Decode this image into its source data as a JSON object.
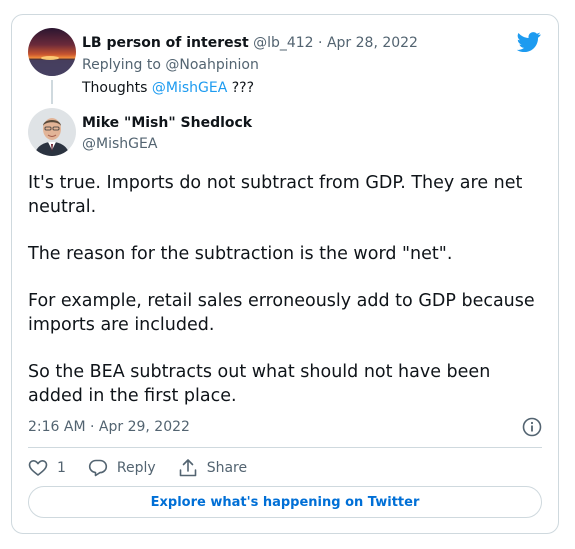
{
  "reply_tweet": {
    "author_name": "LB person of interest",
    "handle": "@lb_412",
    "separator": "·",
    "date": "Apr 28, 2022",
    "replying_prefix": "Replying to",
    "replying_to": "@Noahpinion",
    "text_prefix": "Thoughts",
    "mention": "@MishGEA",
    "text_suffix": "???",
    "avatar_icon": "sunset-avatar"
  },
  "main_tweet": {
    "author_name": "Mike \"Mish\" Shedlock",
    "handle": "@MishGEA",
    "avatar_icon": "man-portrait-avatar",
    "paragraphs": [
      "It's true. Imports do not subtract from GDP. They are net neutral.",
      "The reason for the subtraction is the word \"net\".",
      "For example, retail sales erroneously add to GDP because imports are included.",
      "So the BEA subtracts out what should not have been added in the first place."
    ],
    "timestamp": "2:16 AM · Apr 29, 2022"
  },
  "actions": {
    "like_count": "1",
    "reply_label": "Reply",
    "share_label": "Share"
  },
  "explore_label": "Explore what's happening on Twitter",
  "colors": {
    "twitter_blue": "#1d9bf0",
    "link_blue": "#1d9bf0",
    "button_text": "#006fd6",
    "muted_text": "#536471",
    "border": "#cfd9de"
  }
}
